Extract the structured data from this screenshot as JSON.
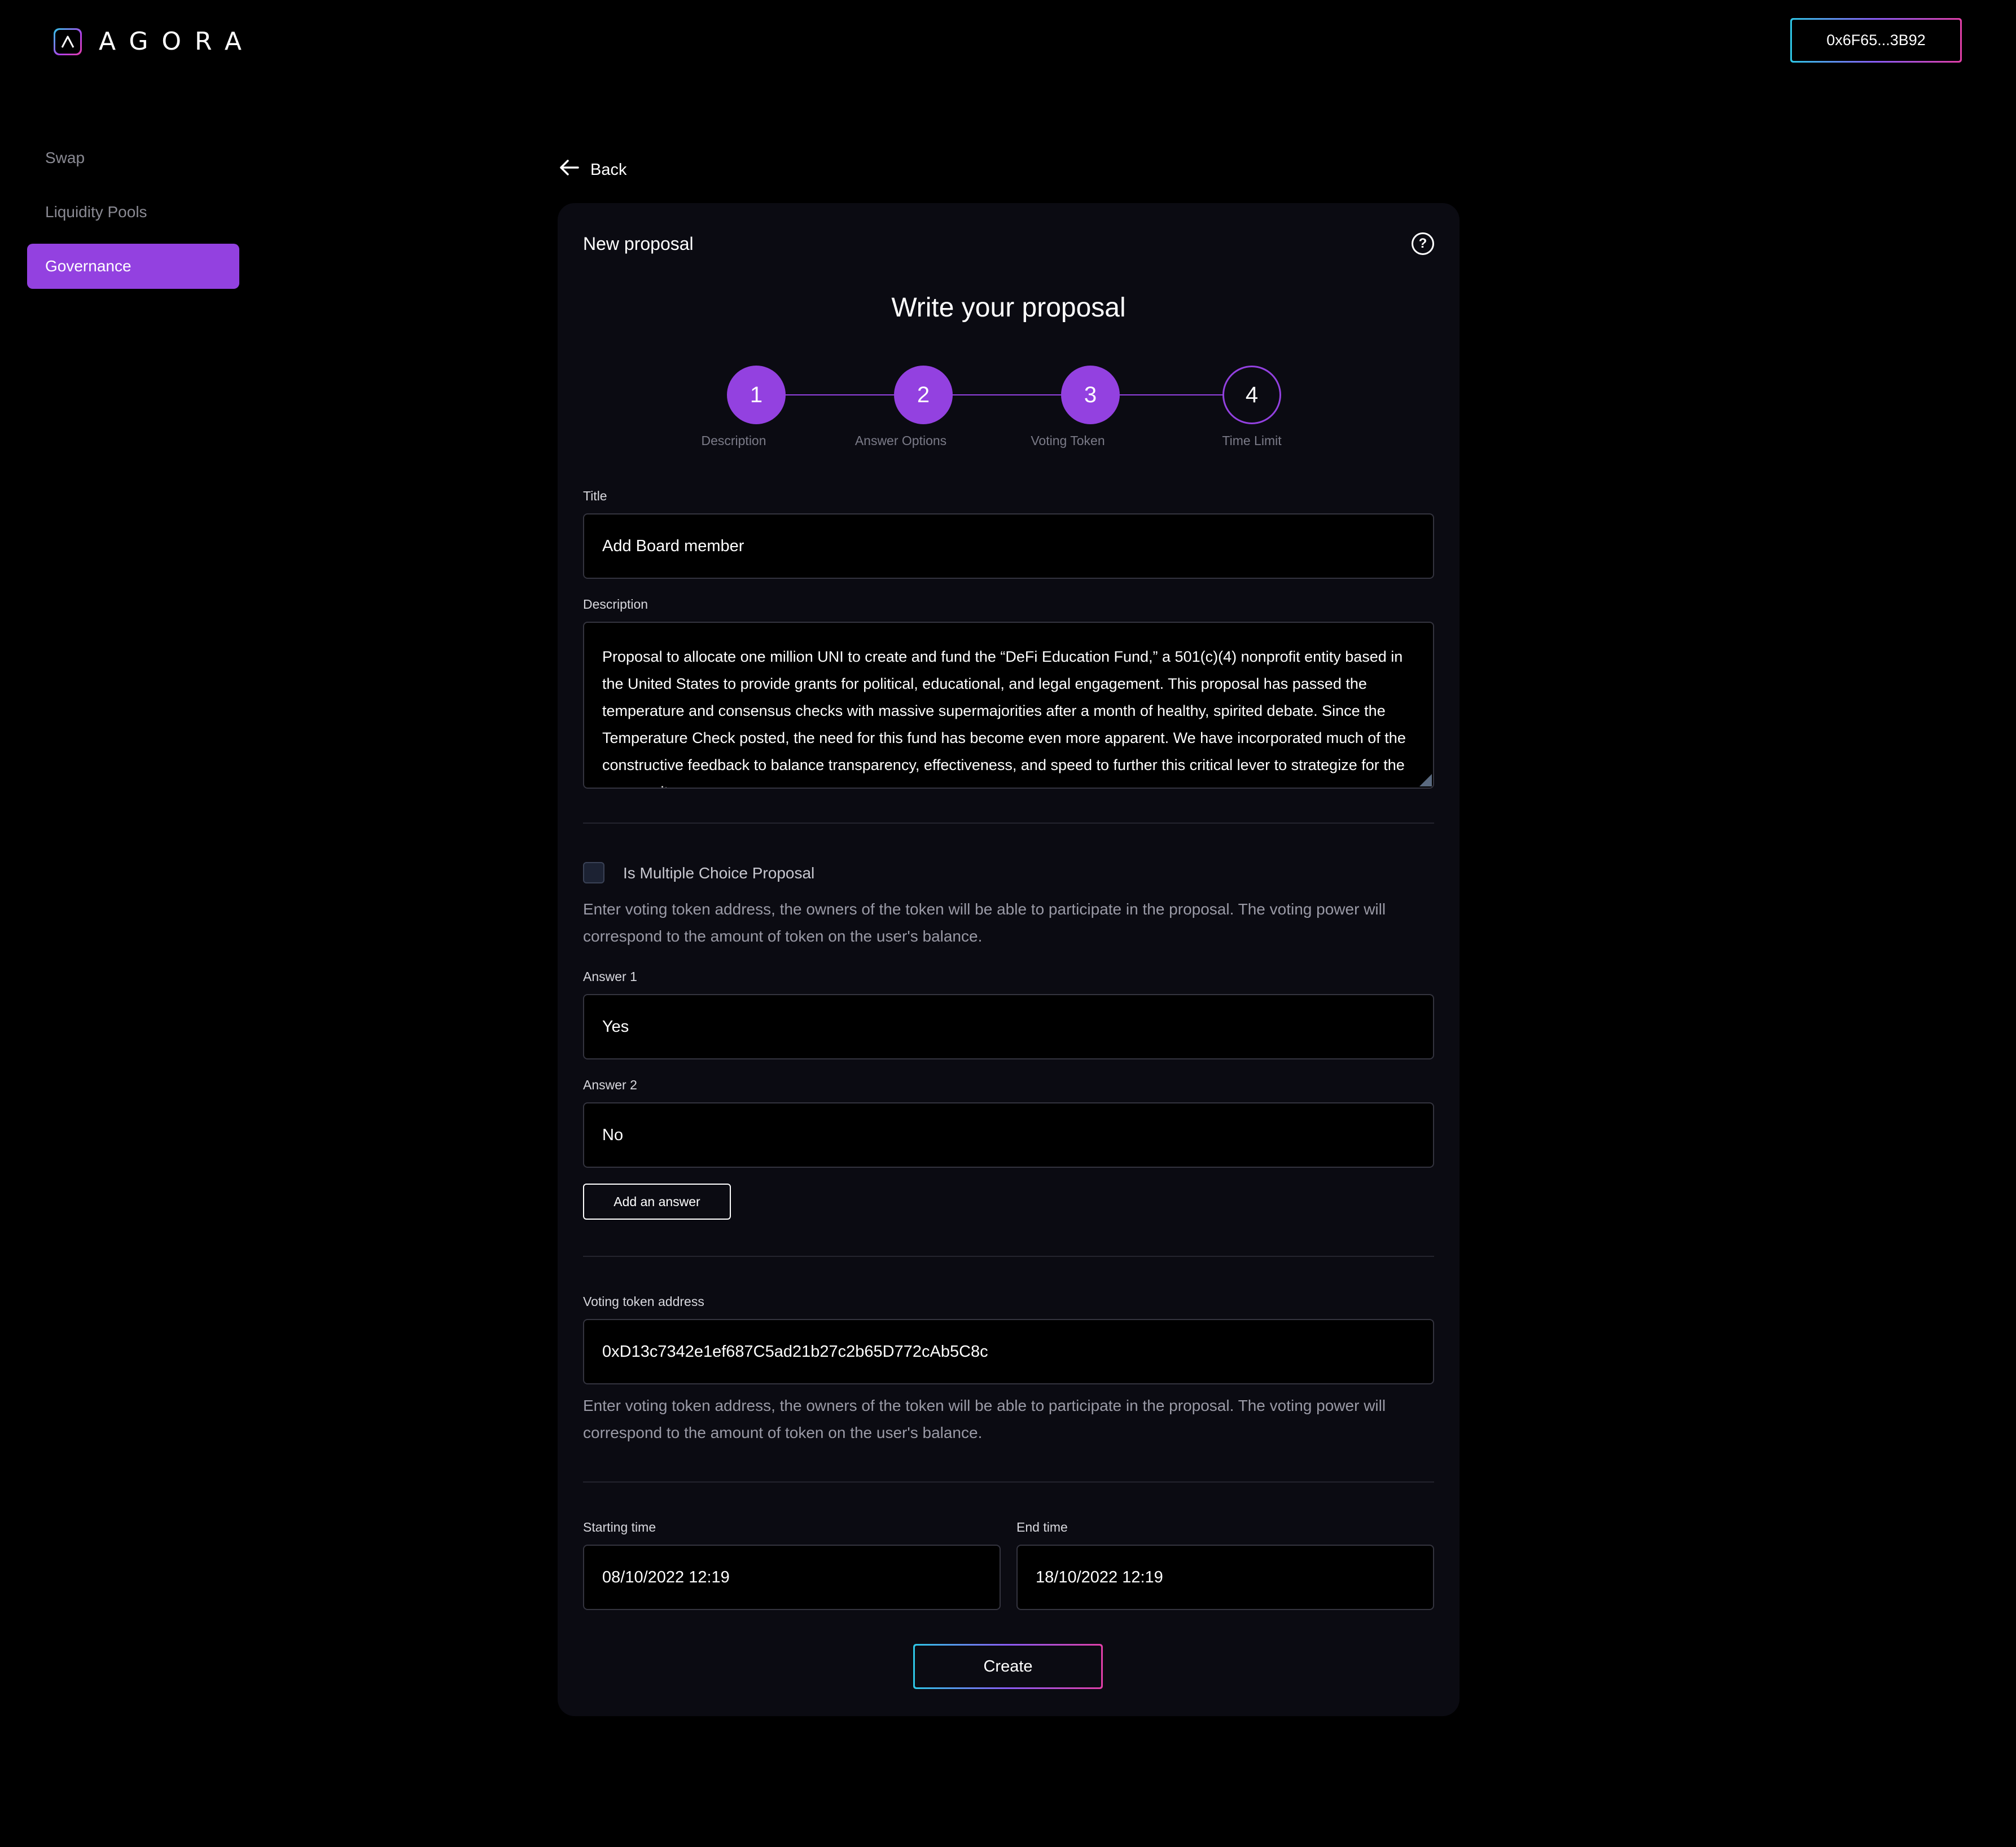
{
  "header": {
    "brand": "AGORA",
    "wallet_address": "0x6F65...3B92"
  },
  "sidebar": {
    "items": [
      {
        "label": "Swap",
        "active": false
      },
      {
        "label": "Liquidity Pools",
        "active": false
      },
      {
        "label": "Governance",
        "active": true
      }
    ]
  },
  "back_label": "Back",
  "card": {
    "title": "New proposal",
    "heading": "Write your proposal"
  },
  "steps": [
    {
      "number": "1",
      "label": "Description",
      "completed": true
    },
    {
      "number": "2",
      "label": "Answer Options",
      "completed": true
    },
    {
      "number": "3",
      "label": "Voting Token",
      "completed": true
    },
    {
      "number": "4",
      "label": "Time Limit",
      "completed": false
    }
  ],
  "form": {
    "title_label": "Title",
    "title_value": "Add Board member",
    "description_label": "Description",
    "description_value": "Proposal to allocate one million UNI to create and fund the “DeFi Education Fund,” a 501(c)(4) nonprofit entity based in the United States to provide grants for political, educational, and legal engagement. This proposal has passed the temperature and consensus checks with massive supermajorities after a month of healthy, spirited debate. Since the Temperature Check posted, the need for this fund has become even more apparent. We have incorporated much of the constructive feedback to balance transparency, effectiveness, and speed to further this critical lever to strategize for the community.",
    "multiple_choice_label": "Is Multiple Choice Proposal",
    "multiple_choice_checked": false,
    "answers_help": "Enter voting token address, the owners of the token will be able to participate in the proposal. The voting power will correspond to the amount of token on the user's balance.",
    "answer1_label": "Answer 1",
    "answer1_value": "Yes",
    "answer2_label": "Answer 2",
    "answer2_value": "No",
    "add_answer_label": "Add an answer",
    "token_label": "Voting token address",
    "token_value": "0xD13c7342e1ef687C5ad21b27c2b65D772cAb5C8c",
    "token_help": "Enter voting token address, the owners of the token will be able to participate in the proposal. The voting power will correspond to the amount of token on the user's balance.",
    "start_label": "Starting time",
    "start_value": "08/10/2022 12:19",
    "end_label": "End time",
    "end_value": "18/10/2022 12:19",
    "create_label": "Create"
  },
  "colors": {
    "accent": "#9341e0",
    "background": "#000000",
    "card": "#0b0b12",
    "gradient_start": "#2ec7e6",
    "gradient_end": "#e23fa8"
  }
}
